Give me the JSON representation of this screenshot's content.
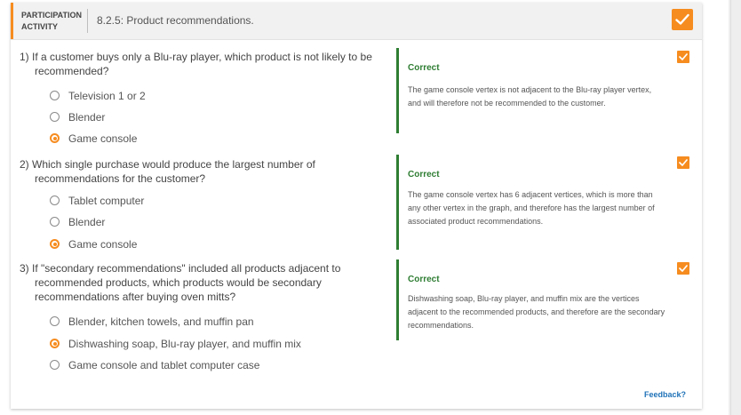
{
  "header": {
    "participation_label": "PARTICIPATION ACTIVITY",
    "activity_title": "8.2.5: Product recommendations."
  },
  "questions": [
    {
      "number": "1)",
      "text": "If a customer buys only a Blu-ray player, which product is not likely to be recommended?",
      "options": [
        "Television 1 or 2",
        "Blender",
        "Game console"
      ],
      "selected_index": 2,
      "feedback_status": "Correct",
      "feedback_text": "The game console vertex is not adjacent to the Blu-ray player vertex, and will therefore not be recommended to the customer."
    },
    {
      "number": "2)",
      "text": "Which single purchase would produce the largest number of recommendations for the customer?",
      "options": [
        "Tablet computer",
        "Blender",
        "Game console"
      ],
      "selected_index": 2,
      "feedback_status": "Correct",
      "feedback_text": "The game console vertex has 6 adjacent vertices, which is more than any other vertex in the graph, and therefore has the largest number of associated product recommendations."
    },
    {
      "number": "3)",
      "text": "If \"secondary recommendations\" included all products adjacent to recommended products, which products would be secondary recommendations after buying oven mitts?",
      "options": [
        "Blender, kitchen towels, and muffin pan",
        "Dishwashing soap, Blu-ray player, and muffin mix",
        "Game console and tablet computer case"
      ],
      "selected_index": 1,
      "feedback_status": "Correct",
      "feedback_text": "Dishwashing soap, Blu-ray player, and muffin mix are the vertices adjacent to the recommended products, and therefore are the secondary recommendations."
    }
  ],
  "footer": {
    "feedback_link": "Feedback?"
  },
  "colors": {
    "accent": "#f68c1f",
    "correct": "#2e7d32",
    "link": "#1f72b8"
  },
  "icons": {
    "completion": "checkmark-icon",
    "question_status": "checkmark-icon"
  }
}
